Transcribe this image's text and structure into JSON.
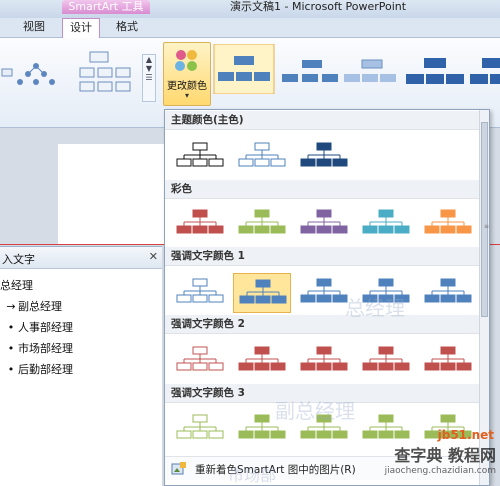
{
  "window": {
    "context_tab": "SmartArt 工具",
    "title": "演示文稿1 - Microsoft PowerPoint"
  },
  "tabs": [
    "视图",
    "设计",
    "格式"
  ],
  "ribbon": {
    "change_colors_label": "更改颜色",
    "change_colors_arrow": "▾",
    "gallery_scroll": [
      "▲",
      "▼",
      "☰"
    ]
  },
  "text_pane": {
    "title": "入文字",
    "close": "✕",
    "items": [
      {
        "text": "总经理",
        "bullet": ""
      },
      {
        "text": "副总经理",
        "bullet": "→"
      },
      {
        "text": "人事部经理",
        "bullet": "•"
      },
      {
        "text": "市场部经理",
        "bullet": "•"
      },
      {
        "text": "后勤部经理",
        "bullet": "•"
      }
    ]
  },
  "dropdown": {
    "sections": [
      {
        "label": "主题颜色(主色)"
      },
      {
        "label": "彩色"
      },
      {
        "label": "强调文字颜色 1"
      },
      {
        "label": "强调文字颜色 2"
      },
      {
        "label": "强调文字颜色 3"
      }
    ],
    "footer": "重新着色SmartArt 图中的图片(R)"
  },
  "colors": {
    "accent_blue": "#4f81bd",
    "dark_blue": "#1f497d",
    "red": "#c0504d",
    "green": "#9bbb59",
    "purple": "#8064a2",
    "aqua": "#4bacc6",
    "orange": "#f79646"
  },
  "watermark": {
    "lines": [
      "总经理",
      "副总经理",
      "市场部"
    ],
    "site": "jb51.net",
    "brand": "查字典 教程网",
    "url": "jiaocheng.chazidian.com"
  }
}
